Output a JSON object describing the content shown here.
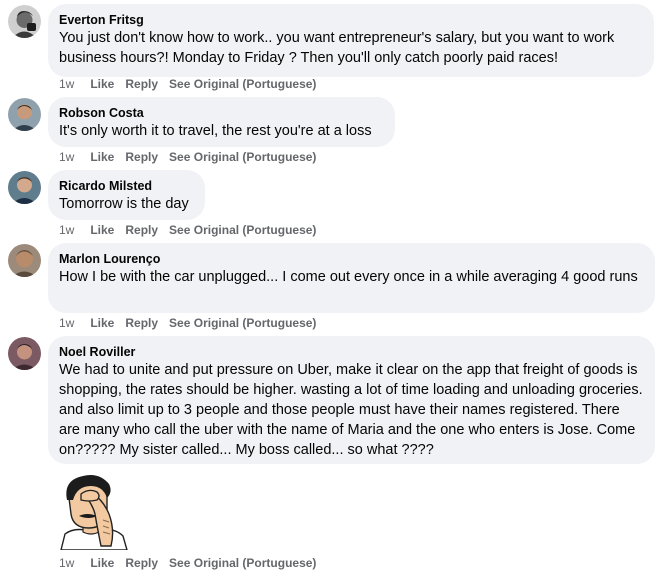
{
  "comments": [
    {
      "author": "Everton Fritsg",
      "text": "You just don't know how to work.. you want entrepreneur's salary, but you want to work business hours?! Monday to Friday ? Then you'll only catch poorly paid races!",
      "time": "1w",
      "like": "Like",
      "reply": "Reply",
      "see_original": "See Original (Portuguese)"
    },
    {
      "author": "Robson Costa",
      "text": "It's only worth it to travel, the rest you're at a loss",
      "time": "1w",
      "like": "Like",
      "reply": "Reply",
      "see_original": "See Original (Portuguese)"
    },
    {
      "author": "Ricardo Milsted",
      "text": "Tomorrow is the day",
      "time": "1w",
      "like": "Like",
      "reply": "Reply",
      "see_original": "See Original (Portuguese)"
    },
    {
      "author": "Marlon Lourenço",
      "text": "How I be with the car unplugged... I come out every once in a while averaging 4 good runs",
      "time": "1w",
      "like": "Like",
      "reply": "Reply",
      "see_original": "See Original (Portuguese)"
    },
    {
      "author": "Noel Roviller",
      "text": "We had to unite and put pressure on Uber, make it clear on the app that freight of goods is shopping, the rates should be higher. wasting a lot of time loading and unloading groceries. and also limit up to 3 people and those people must have their names registered. There are many who call the uber with the name of Maria and the one who enters is Jose. Come on????? My sister called... My boss called... so what ????",
      "time": "1w",
      "like": "Like",
      "reply": "Reply",
      "see_original": "See Original (Portuguese)"
    }
  ],
  "sticker_reply": {
    "sticker_icon": "facepalm-sticker-icon",
    "time": "1w",
    "like": "Like",
    "reply": "Reply",
    "see_original": "See Original (Portuguese)"
  },
  "colors": {
    "bubble": "#f0f2f5",
    "meta_text": "#65676b",
    "primary_text": "#050505"
  }
}
